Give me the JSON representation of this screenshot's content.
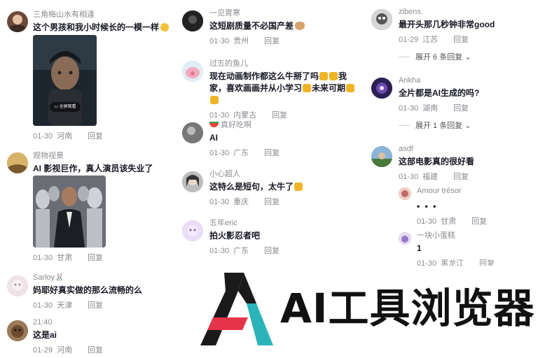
{
  "columns": [
    {
      "comments": [
        {
          "user": "三角梅山水有相逢",
          "text": "这个男孩和我小时候长的一模一样",
          "date": "01-30",
          "location": "河南",
          "reply": "回复",
          "photo_label": "全屏观看",
          "avatar_color": "#6b4a3a"
        },
        {
          "user": "观物视景",
          "text": "AI 影视巨作，真人演员该失业了",
          "date": "01-30",
          "location": "甘肃",
          "reply": "回复",
          "avatar_color": "#c9a25a"
        },
        {
          "user": "Sarloy🐰",
          "text": "妈耶好真实做的那么流畅的么",
          "date": "01-30",
          "location": "天津",
          "reply": "回复",
          "avatar_color": "#e8d6de"
        },
        {
          "user": "21:40",
          "text": "这是ai",
          "date": "01-29",
          "location": "河南",
          "reply": "回复",
          "avatar_color": "#8a6a4a"
        }
      ]
    },
    {
      "comments": [
        {
          "user": "一见胃寒",
          "text": "这短剧质量不必国产差",
          "date": "01-30",
          "location": "贵州",
          "reply": "回复",
          "avatar_color": "#2b2b2b"
        },
        {
          "user": "过五的鱼儿",
          "text": "现在动画制作都这么牛掰了吗",
          "text2": "我家，喜欢画画并从小学习",
          "text3": "未来可期",
          "date": "01-30",
          "location": "内蒙古",
          "reply": "回复",
          "avatar_color": "#f2b8c6"
        },
        {
          "user": "真好吃啊",
          "text": "AI",
          "date": "01-30",
          "location": "广东",
          "reply": "回复",
          "avatar_color": "#6e6e6e"
        },
        {
          "user": "小心超人",
          "text": "这特么是短句，太牛了",
          "date": "01-30",
          "location": "重庆",
          "reply": "回复",
          "avatar_color": "#9a9a9a"
        },
        {
          "user": "五年eric",
          "text": "拍火影忍者吧",
          "date": "01-30",
          "location": "广东",
          "reply": "回复",
          "avatar_color": "#d9c8f0"
        }
      ]
    },
    {
      "comments": [
        {
          "user": "zibens.",
          "text": "最开头那几秒钟非常good",
          "date": "01-29",
          "location": "江苏",
          "reply": "回复",
          "expand": "展开 6 条回复",
          "avatar_color": "#4a4a4a"
        },
        {
          "user": "Ankha",
          "text": "全片都是AI生成的吗?",
          "date": "01-30",
          "location": "湖南",
          "reply": "回复",
          "expand": "展开 1 条回复",
          "avatar_color": "#3b2a6a"
        },
        {
          "user": "asdf",
          "text": "这部电影真的很好看",
          "date": "01-30",
          "location": "福建",
          "reply": "回复",
          "avatar_color": "#5a8ab8"
        }
      ],
      "replies": [
        {
          "user": "Amour trésor",
          "text": "• • •",
          "date": "01-30",
          "location": "甘肃",
          "reply": "回复",
          "avatar_color": "#c98a8a"
        },
        {
          "user": "一块小蛋糕",
          "text": "1",
          "date": "01-30",
          "location": "黑龙江",
          "reply": "回复",
          "avatar_color": "#b79ad6"
        }
      ]
    }
  ],
  "logo": {
    "text": "AI工具浏览器",
    "colors": {
      "black": "#1a1a1a",
      "red": "#e5334a",
      "teal": "#2ab3b8"
    }
  }
}
